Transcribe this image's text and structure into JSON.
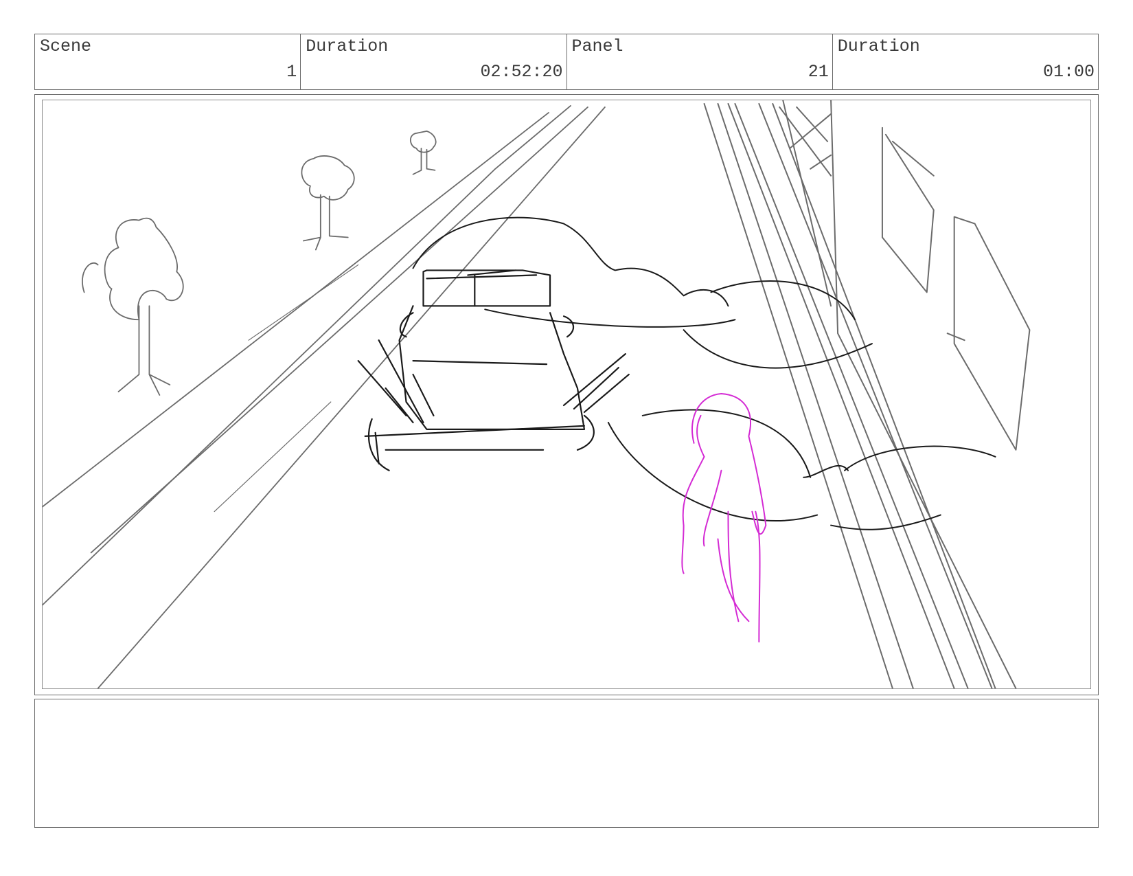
{
  "header": {
    "cells": [
      {
        "label": "Scene",
        "value": "1"
      },
      {
        "label": "Duration",
        "value": "02:52:20"
      },
      {
        "label": "Panel",
        "value": "21"
      },
      {
        "label": "Duration",
        "value": "01:00"
      }
    ]
  },
  "sketch": {
    "line_color": "#1a1a1a",
    "pencil_color": "#6b6b6b",
    "highlight_color": "#d42bd4"
  },
  "notes": {
    "text": ""
  }
}
